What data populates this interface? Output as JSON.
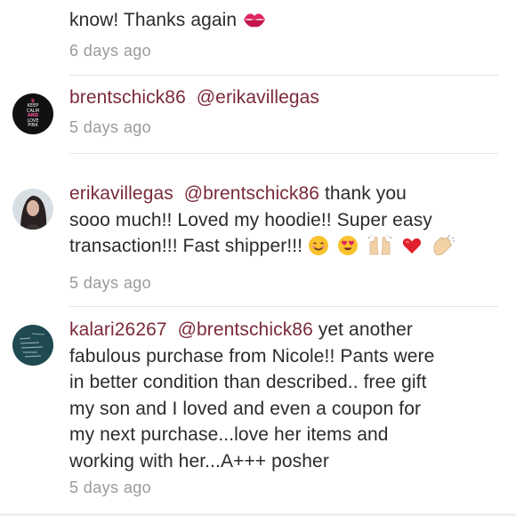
{
  "comments": [
    {
      "text_partial": "know! Thanks again",
      "time": "6 days ago"
    },
    {
      "username": "brentschick86",
      "mention": "@erikavillegas",
      "text": "",
      "time": "5 days ago",
      "avatar": {
        "icon": "keep-calm-love-pink-avatar",
        "line1": "KEEP",
        "line2": "CALM",
        "line3": "AND",
        "line4": "LOVE",
        "line5": "PINK"
      }
    },
    {
      "username": "erikavillegas",
      "mention": "@brentschick86",
      "text_line1": "thank you",
      "text_line2": "sooo much!! Loved my hoodie!! Super easy",
      "text_line3": "transaction!!! Fast shipper!!!",
      "time": "5 days ago",
      "emojis": [
        "smiling-face-emoji",
        "heart-eyes-emoji",
        "raising-hands-emoji",
        "red-heart-emoji",
        "clapping-hands-emoji"
      ],
      "avatar": {
        "icon": "user-photo-avatar"
      }
    },
    {
      "username": "kalari26267",
      "mention": "@brentschick86",
      "text_line1": "yet another",
      "text_line2": "fabulous purchase from Nicole!! Pants were",
      "text_line3": "in better condition than described.. free gift",
      "text_line4": "my son and I loved and even a coupon for",
      "text_line5": "my next purchase...love her items and",
      "text_line6": "working with her...A+++ posher",
      "time": "5 days ago",
      "avatar": {
        "icon": "chalkboard-avatar"
      }
    }
  ],
  "colors": {
    "username": "#7b2a3a",
    "time": "#9a9a9a",
    "text": "#2b2b2b"
  }
}
